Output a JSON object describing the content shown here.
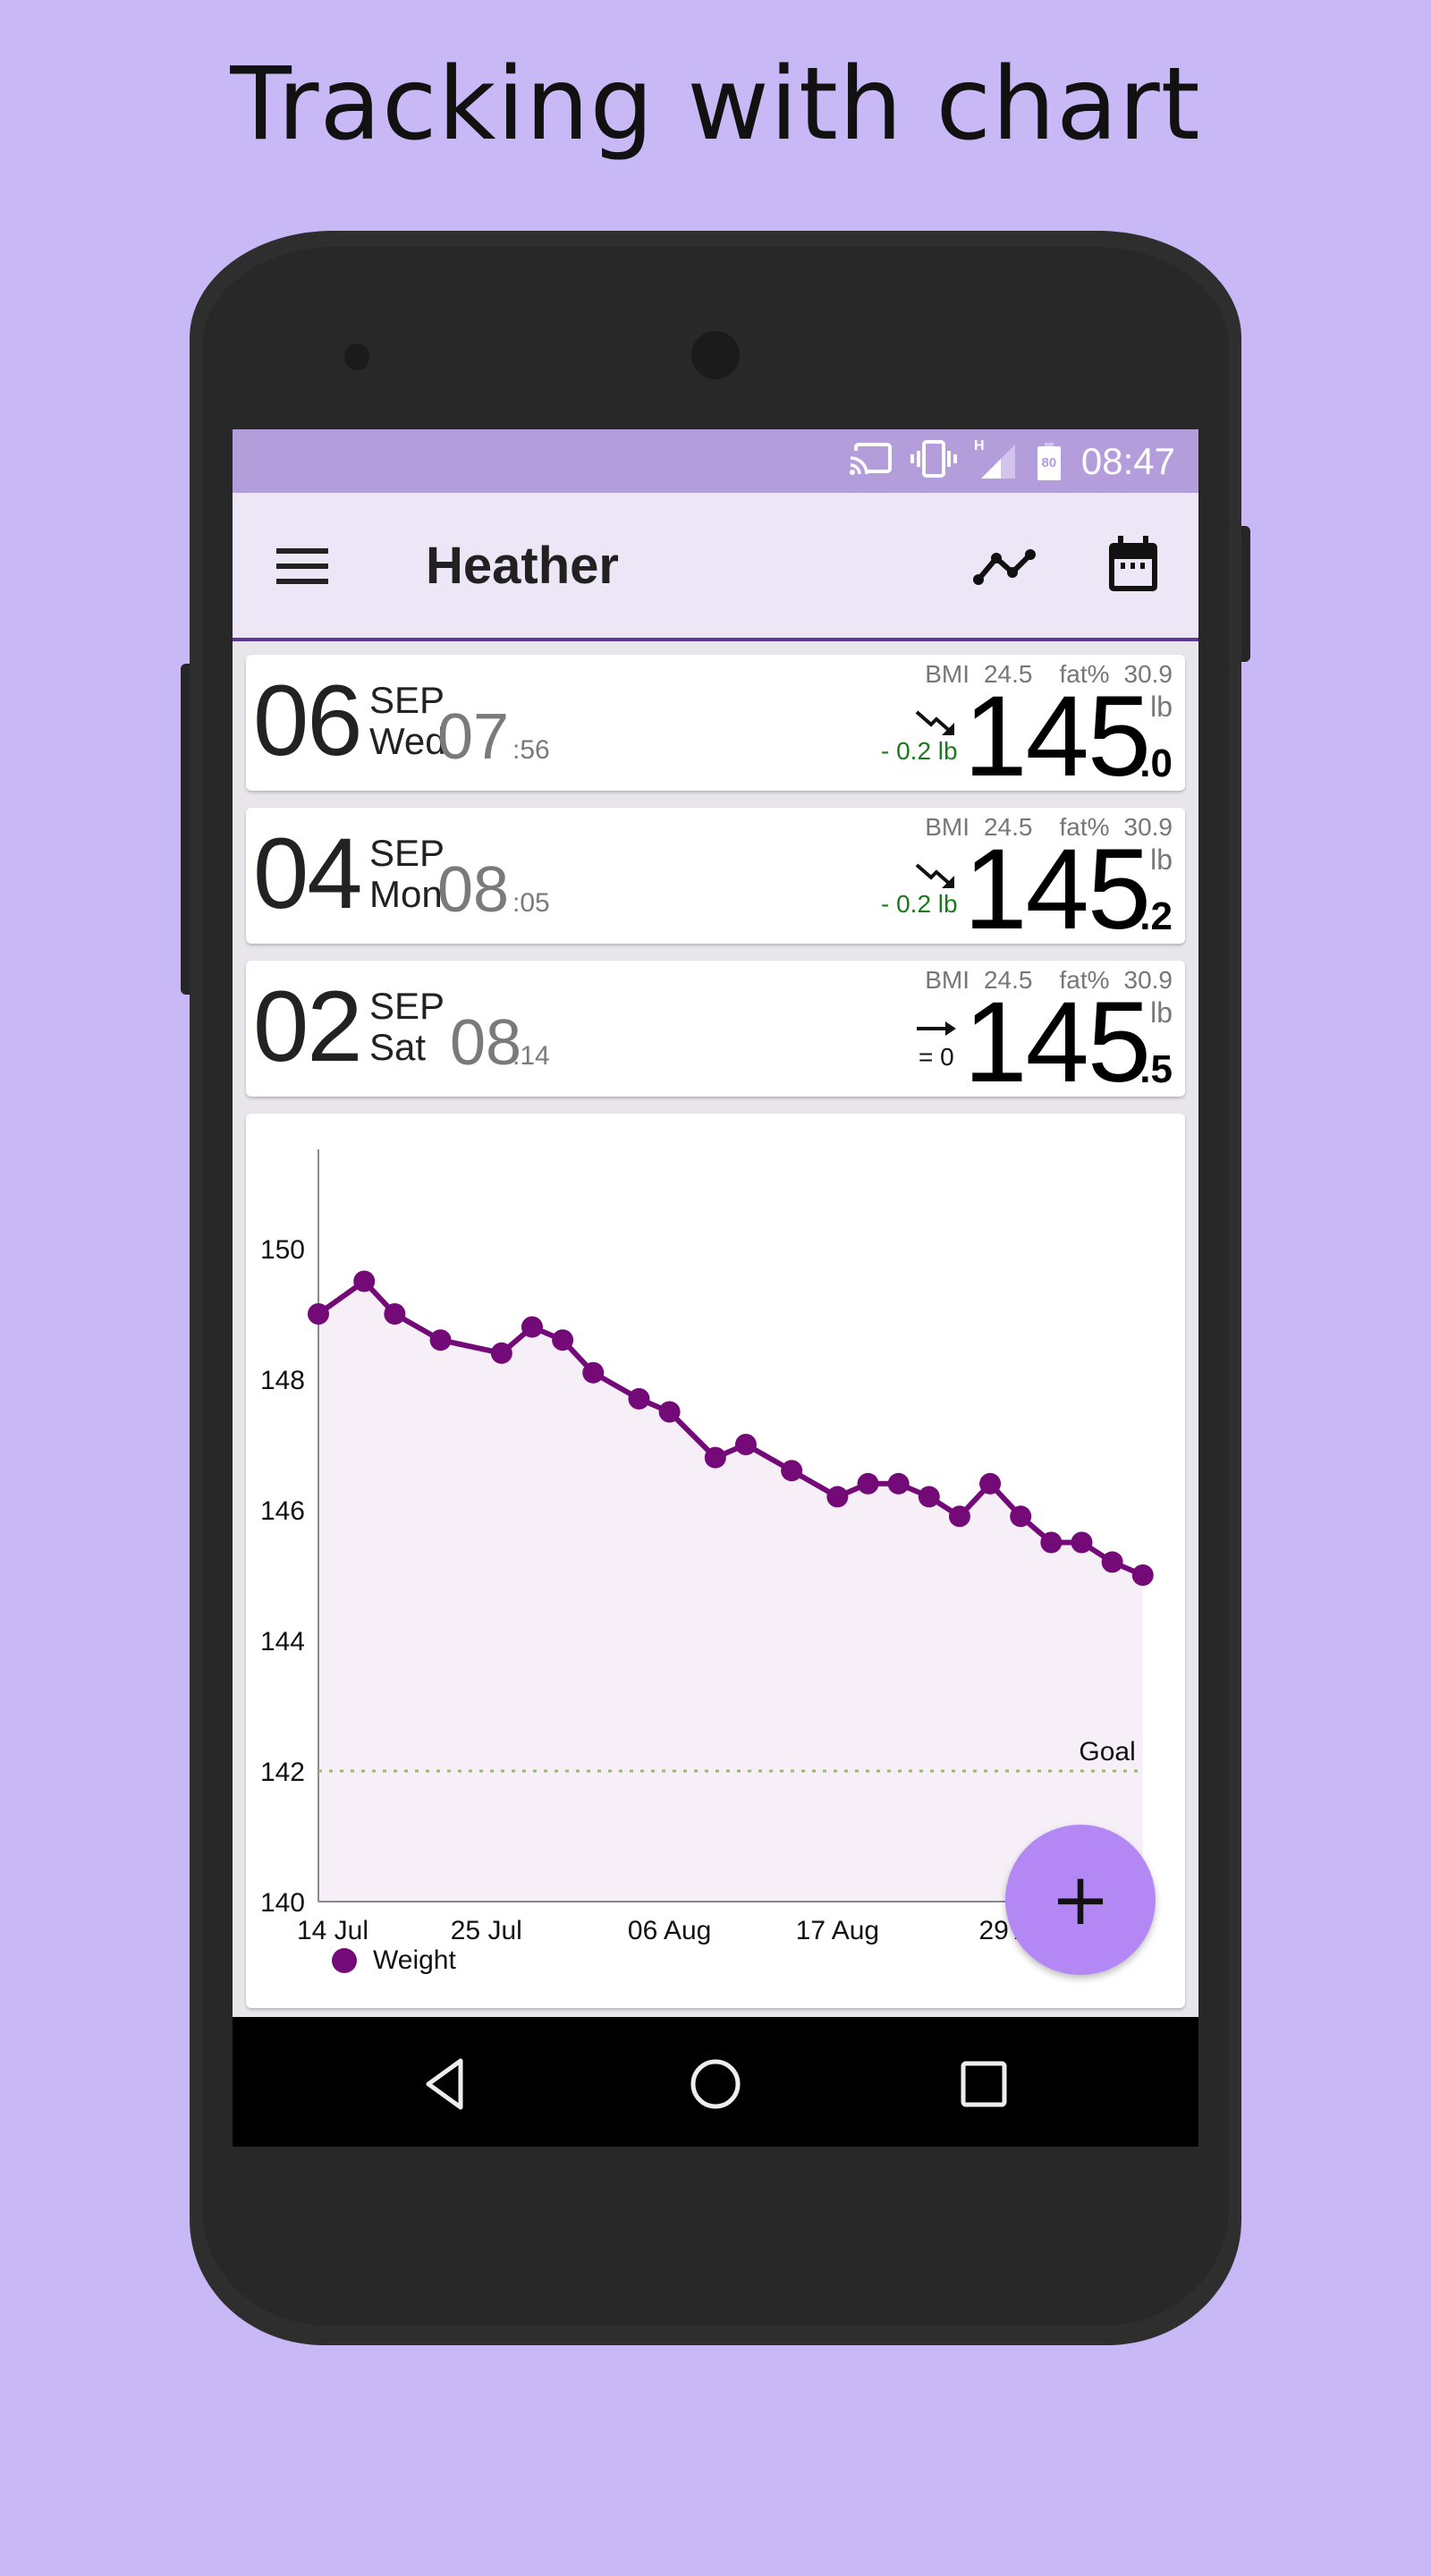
{
  "headline": "Tracking with chart",
  "status_bar": {
    "time": "08:47",
    "battery_level": "80",
    "network_type": "H",
    "icons": [
      "cast-icon",
      "vibrate-icon",
      "signal-icon",
      "battery-icon"
    ]
  },
  "app_bar": {
    "title": "Heather",
    "icons": [
      "menu-icon",
      "chart-line-icon",
      "calendar-icon"
    ]
  },
  "colors": {
    "accent": "#730a78",
    "status_bar": "#b39ddb",
    "app_bar": "#ede6f6",
    "fab": "#b388f5",
    "decrease": "#1b7a1b",
    "goal_line": "#9ab86a"
  },
  "entries": [
    {
      "day": "06",
      "month": "SEP",
      "weekday": "Wed",
      "hour": "07",
      "minute": ":56",
      "bmi_label": "BMI",
      "bmi": "24.5",
      "fat_label": "fat%",
      "fat": "30.9",
      "trend": "down",
      "change": "- 0.2 lb",
      "weight_int": "145",
      "weight_dec": ".0",
      "unit": "lb"
    },
    {
      "day": "04",
      "month": "SEP",
      "weekday": "Mon",
      "hour": "08",
      "minute": ":05",
      "bmi_label": "BMI",
      "bmi": "24.5",
      "fat_label": "fat%",
      "fat": "30.9",
      "trend": "down",
      "change": "- 0.2 lb",
      "weight_int": "145",
      "weight_dec": ".2",
      "unit": "lb"
    },
    {
      "day": "02",
      "month": "SEP",
      "weekday": "Sat",
      "hour": "08",
      "minute": ":14",
      "bmi_label": "BMI",
      "bmi": "24.5",
      "fat_label": "fat%",
      "fat": "30.9",
      "trend": "flat",
      "change": "= 0",
      "weight_int": "145",
      "weight_dec": ".5",
      "unit": "lb"
    }
  ],
  "chart_data": {
    "type": "line",
    "title": "",
    "xlabel": "",
    "ylabel": "",
    "ylim": [
      140,
      151.5
    ],
    "yticks": [
      140,
      142,
      144,
      146,
      148,
      150
    ],
    "x_start_label": "14 Jul",
    "x_range_days": [
      0,
      54
    ],
    "xticks": [
      {
        "day": 0,
        "label": "14 Jul"
      },
      {
        "day": 11,
        "label": "25 Jul"
      },
      {
        "day": 23,
        "label": "06 Aug"
      },
      {
        "day": 34,
        "label": "17 Aug"
      },
      {
        "day": 46,
        "label": "29 Aug"
      }
    ],
    "grid": false,
    "area_fill": true,
    "series": [
      {
        "name": "Weight",
        "x": [
          0,
          3,
          5,
          8,
          12,
          14,
          16,
          18,
          21,
          23,
          26,
          28,
          31,
          34,
          36,
          38,
          40,
          42,
          44,
          46,
          48,
          50,
          52,
          54
        ],
        "values": [
          149.0,
          149.5,
          149.0,
          148.6,
          148.4,
          148.8,
          148.6,
          148.1,
          147.7,
          147.5,
          146.8,
          147.0,
          146.6,
          146.2,
          146.4,
          146.4,
          146.2,
          145.9,
          146.4,
          145.9,
          145.5,
          145.5,
          145.2,
          145.0
        ]
      }
    ],
    "goal": {
      "value": 142,
      "label": "Goal"
    },
    "legend": {
      "position": "bottom-left",
      "entries": [
        "Weight"
      ]
    }
  },
  "fab": {
    "label": "+",
    "icon": "add-icon"
  },
  "nav_bar": {
    "buttons": [
      "back",
      "home",
      "recents"
    ]
  }
}
